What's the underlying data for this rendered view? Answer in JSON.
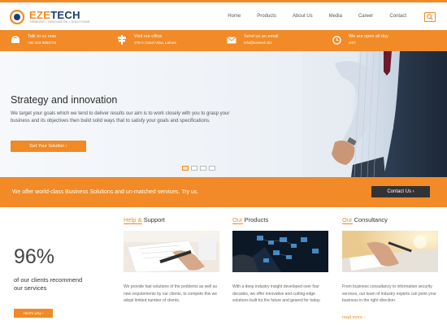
{
  "brand": {
    "name_part1": "EZE",
    "name_part2": "TECH",
    "tagline": "THINKING • INNOVATION • SOLUTIONS"
  },
  "nav": {
    "items": [
      "Home",
      "Products",
      "About Us",
      "Media",
      "Career",
      "Contact"
    ],
    "search_icon": "search-icon"
  },
  "infobar": {
    "items": [
      {
        "title": "Talk to us now",
        "detail": "+52 423 5964723",
        "icon": "phone-icon"
      },
      {
        "title": "Visit our office",
        "detail": "278-A Canal View, Lahore",
        "icon": "signpost-icon"
      },
      {
        "title": "Send us an email",
        "detail": "info@ezetech.biz",
        "icon": "email-icon"
      },
      {
        "title": "We are open all day",
        "detail": "24/7",
        "icon": "clock-icon"
      }
    ]
  },
  "hero": {
    "title": "Strategy and innovation",
    "text": "We target your goals which we tend to deliver results our aim is to work closely with you to grasp your business and its objectives then build solid ways that to satisfy your goals and specifications.",
    "button": "Get Your Solution ›",
    "slide_count": 4,
    "active_slide": 1
  },
  "cta": {
    "text": "We offer world-class Business Solutions and un-matched services. Try us.",
    "button": "Contact Us ›"
  },
  "stats": {
    "value": "96%",
    "text": "of our clients recommend our services",
    "button": "Here's why ›"
  },
  "cards": [
    {
      "title_highlight": "Help &",
      "title_rest": " Support",
      "text": "We provide fast solutions of the problems as well as new requirements by our clients, to compete this we adopt limited number of clients."
    },
    {
      "title_highlight": "Our",
      "title_rest": " Products",
      "text": "With a deep industry insight developed over four decades, we offer innovative and cutting-edge solutions built for the future and geared for today."
    },
    {
      "title_highlight": "Our",
      "title_rest": " Consultancy",
      "text": "From business consultancy to information security services, our team of industry experts can point your business in the right direction."
    }
  ],
  "read_more": "read more ›",
  "colors": {
    "accent": "#f08a24",
    "navy": "#1b3d72",
    "dark_button": "#333333"
  }
}
